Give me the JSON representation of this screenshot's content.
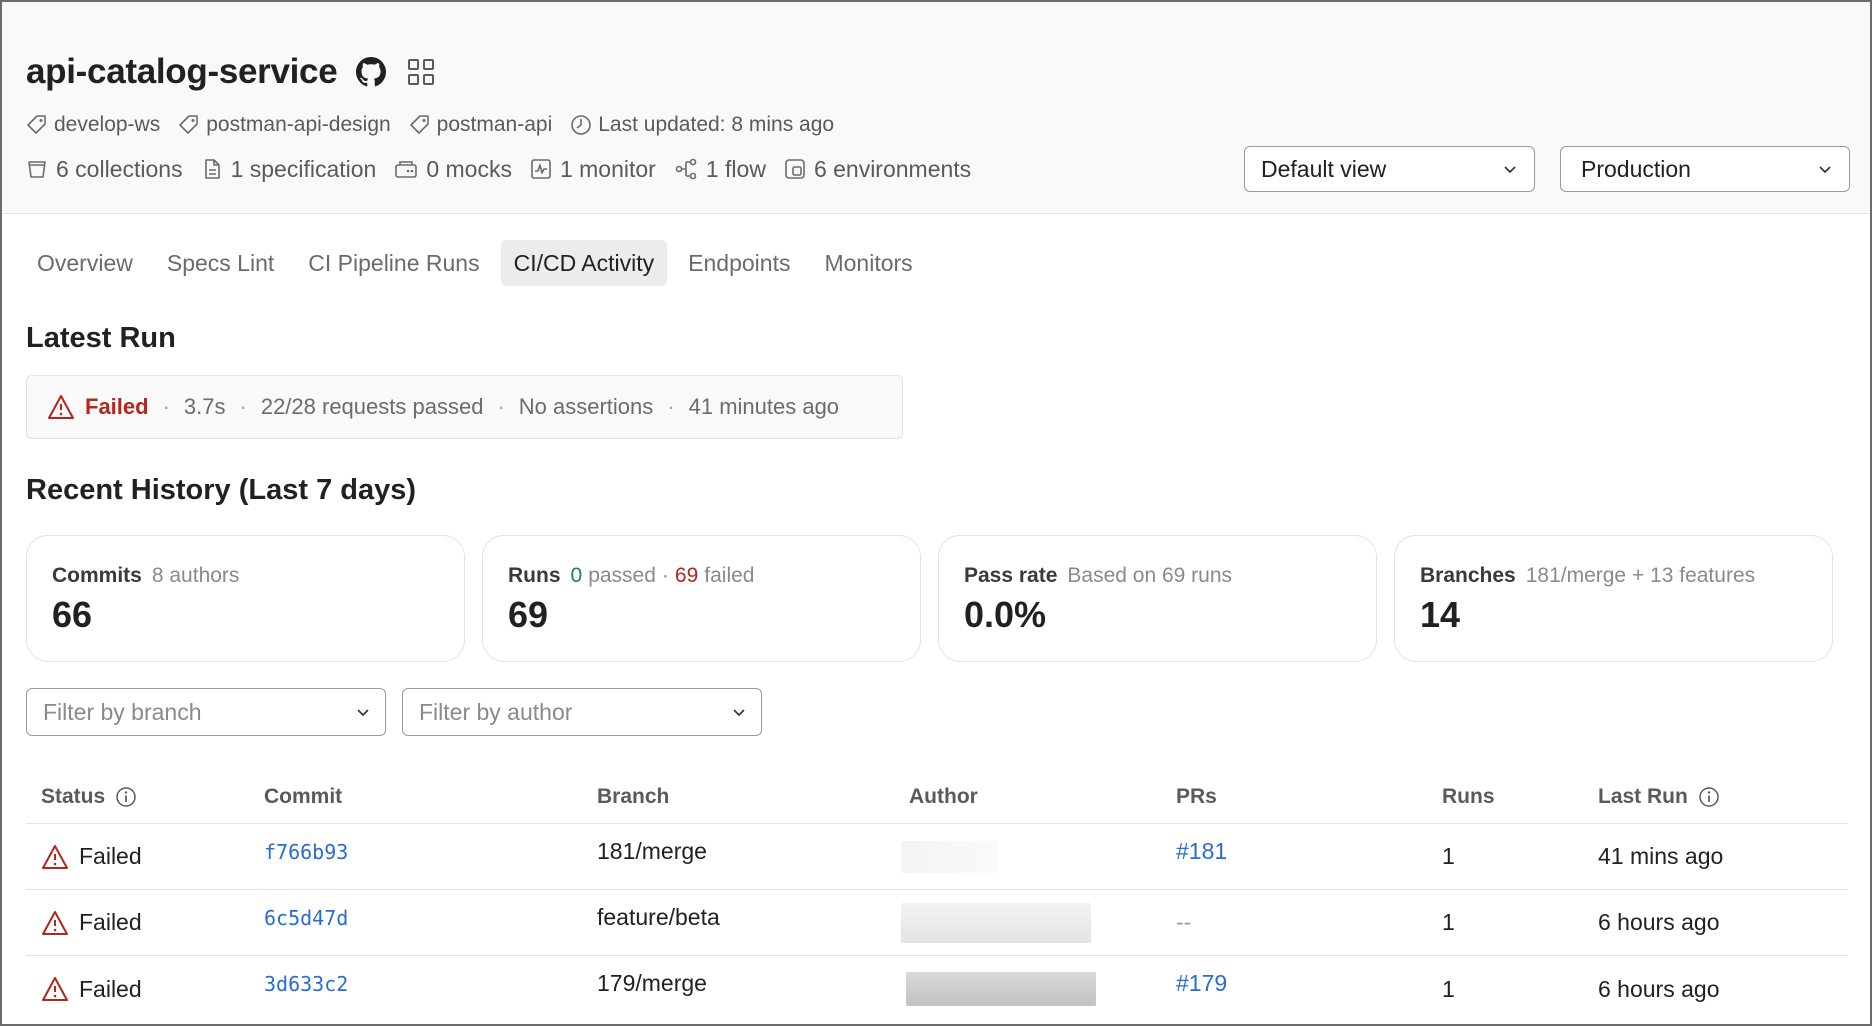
{
  "header": {
    "title": "api-catalog-service",
    "tags": [
      {
        "icon": "tag-icon",
        "label": "develop-ws"
      },
      {
        "icon": "tag-icon",
        "label": "postman-api-design"
      },
      {
        "icon": "tag-icon",
        "label": "postman-api"
      }
    ],
    "last_updated": "Last updated: 8 mins ago",
    "counts": [
      {
        "icon": "collection-icon",
        "label": "6 collections"
      },
      {
        "icon": "document-icon",
        "label": "1 specification"
      },
      {
        "icon": "mock-server-icon",
        "label": "0 mocks"
      },
      {
        "icon": "monitor-icon",
        "label": "1 monitor"
      },
      {
        "icon": "flow-icon",
        "label": "1 flow"
      },
      {
        "icon": "environment-icon",
        "label": "6 environments"
      }
    ],
    "view_select": "Default view",
    "environment_select": "Production"
  },
  "tabs": [
    {
      "label": "Overview",
      "active": false
    },
    {
      "label": "Specs Lint",
      "active": false
    },
    {
      "label": "CI Pipeline Runs",
      "active": false
    },
    {
      "label": "CI/CD Activity",
      "active": true
    },
    {
      "label": "Endpoints",
      "active": false
    },
    {
      "label": "Monitors",
      "active": false
    }
  ],
  "latest_run": {
    "heading": "Latest Run",
    "status": "Failed",
    "duration": "3.7s",
    "requests": "22/28 requests passed",
    "assertions": "No assertions",
    "when": "41 minutes ago"
  },
  "history": {
    "heading": "Recent History (Last 7 days)",
    "commits": {
      "label": "Commits",
      "sub": "8 authors",
      "value": "66"
    },
    "runs": {
      "label": "Runs",
      "passed_count": "0",
      "passed_text": "passed",
      "dot": "·",
      "failed_count": "69",
      "failed_text": "failed",
      "value": "69"
    },
    "pass_rate": {
      "label": "Pass rate",
      "sub": "Based on 69 runs",
      "value": "0.0%"
    },
    "branches": {
      "label": "Branches",
      "sub": "181/merge + 13 features",
      "value": "14"
    }
  },
  "filters": {
    "branch_placeholder": "Filter by branch",
    "author_placeholder": "Filter by author"
  },
  "table": {
    "headers": {
      "status": "Status",
      "commit": "Commit",
      "branch": "Branch",
      "author": "Author",
      "prs": "PRs",
      "runs": "Runs",
      "last_run": "Last Run"
    },
    "rows": [
      {
        "status": "Failed",
        "commit": "f766b93",
        "branch": "181/merge",
        "prs": "#181",
        "runs": "1",
        "last_run": "41 mins ago"
      },
      {
        "status": "Failed",
        "commit": "6c5d47d",
        "branch": "feature/beta",
        "prs": "--",
        "runs": "1",
        "last_run": "6 hours ago"
      },
      {
        "status": "Failed",
        "commit": "3d633c2",
        "branch": "179/merge",
        "prs": "#179",
        "runs": "1",
        "last_run": "6 hours ago"
      }
    ]
  },
  "colors": {
    "failed": "#b3261e",
    "passed": "#1a8a3a",
    "link": "#2a6ccf"
  }
}
